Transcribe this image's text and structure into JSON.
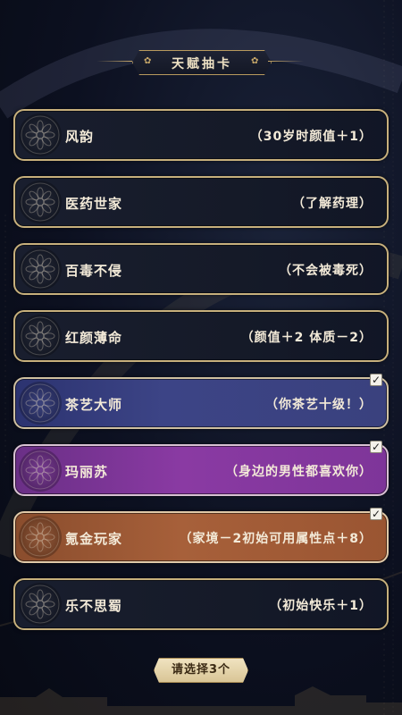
{
  "header": {
    "title": "天赋抽卡"
  },
  "talents": [
    {
      "name": "风韵",
      "desc": "（30岁时颜值＋1）",
      "selected": false
    },
    {
      "name": "医药世家",
      "desc": "（了解药理）",
      "selected": false
    },
    {
      "name": "百毒不侵",
      "desc": "（不会被毒死）",
      "selected": false
    },
    {
      "name": "红颜薄命",
      "desc": "（颜值＋2  体质－2）",
      "selected": false
    },
    {
      "name": "茶艺大师",
      "desc": "（你茶艺十级！）",
      "selected": true,
      "rarity_color": "#3c4486"
    },
    {
      "name": "玛丽苏",
      "desc": "（身边的男性都喜欢你）",
      "selected": true,
      "rarity_color": "#8a3aa3"
    },
    {
      "name": "氪金玩家",
      "desc": "（家境－2初始可用属性点＋8）",
      "selected": true,
      "rarity_color": "#a7603a"
    },
    {
      "name": "乐不思蜀",
      "desc": "（初始快乐＋1）",
      "selected": false
    }
  ],
  "check_mark": "✓",
  "footer": {
    "button_label": "请选择3个"
  },
  "colors": {
    "gold": "#c9a96a",
    "bg": "#0c1020"
  }
}
